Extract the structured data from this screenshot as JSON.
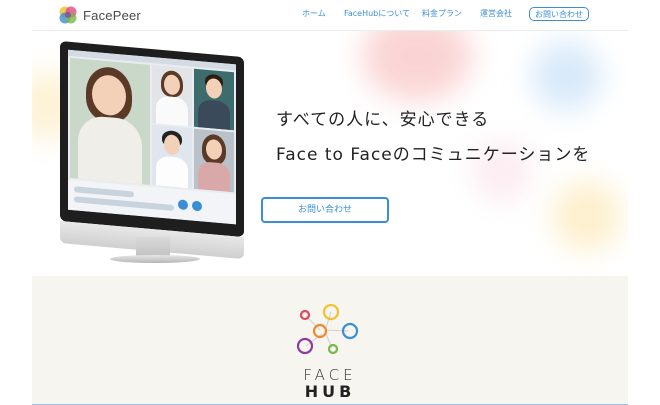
{
  "header": {
    "logo_text": "FacePeer",
    "nav": [
      {
        "label": "ホーム"
      },
      {
        "label": "FaceHubについて"
      },
      {
        "label": "料金プラン"
      },
      {
        "label": "運営会社"
      }
    ],
    "contact_label": "お問い合わせ"
  },
  "hero": {
    "headline_line1": "すべての人に、安心できる",
    "headline_line2": "Face to Faceのコミュニケーションを",
    "cta_label": "お問い合わせ"
  },
  "facehub": {
    "word1": "FACE",
    "word2": "HUB"
  },
  "colors": {
    "accent": "#3a8ed8",
    "headline": "#222222",
    "lower_bg": "#f6f5f0",
    "hub_red": "#e04a5a",
    "hub_yellow": "#f2c230",
    "hub_blue": "#3a8ed8",
    "hub_purple": "#8e3a9e",
    "hub_orange": "#f08a2e",
    "hub_green": "#7ab648"
  }
}
